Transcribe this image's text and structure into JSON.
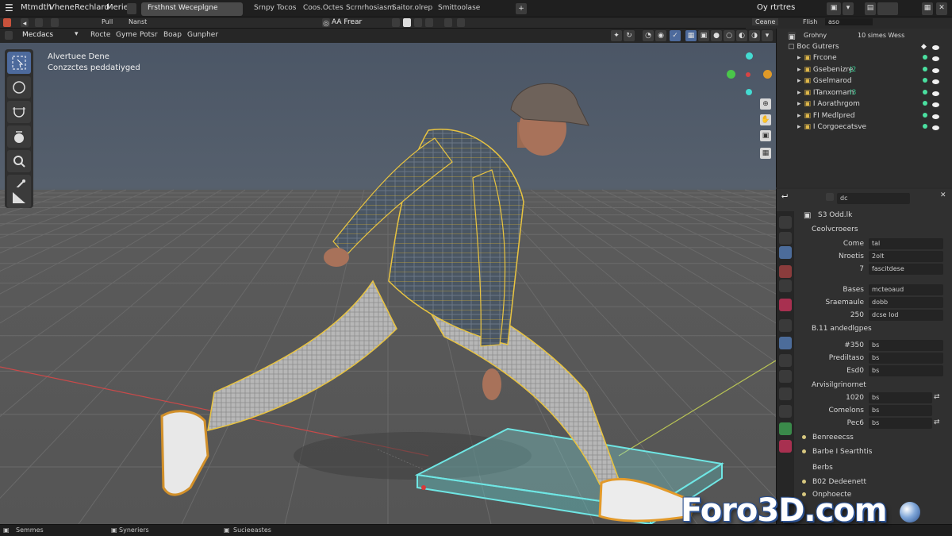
{
  "menubar": {
    "items": [
      "Mtmdth",
      "Vhene",
      "Rechlard",
      "Merie"
    ],
    "active_workspace": "Frsthnst Weceplgne",
    "workspaces": [
      "Srnpy Tocos",
      "Coos.Octes",
      "Scrnrhosiasm",
      "Saitor.olrep",
      "Smittoolase"
    ],
    "right_label": "Oy rtrtres"
  },
  "header": {
    "left_items": [
      "Pull",
      "Nanst"
    ],
    "center_label": "AA Frear",
    "right_items": [
      "Ceane",
      "Flish",
      "aso"
    ]
  },
  "modebar": {
    "mode": "Mecdacs",
    "items": [
      "Rocte",
      "Gyme",
      "Potsr",
      "Boap",
      "Gunpher"
    ]
  },
  "viewport": {
    "overlay_line1": "Alvertuee Dene",
    "overlay_line2": "Conzzctes peddatiyged"
  },
  "outliner": {
    "header": "Grohny",
    "header_right": "10 simes Wess",
    "collection": "Boc Gutrers",
    "items": [
      {
        "name": "Frcone",
        "tag": ""
      },
      {
        "name": "Gsebenizre",
        "tag": "J2"
      },
      {
        "name": "Gselmarod",
        "tag": ""
      },
      {
        "name": "ITanxomam",
        "tag": "I3"
      },
      {
        "name": "I Aorathrgom",
        "tag": ""
      },
      {
        "name": "FI Medlpred",
        "tag": ""
      },
      {
        "name": "I Corgoecatsve",
        "tag": ""
      }
    ]
  },
  "properties": {
    "header_field": "dc",
    "object_name": "S3 Odd.lk",
    "section_title": "Ceolvcroeers",
    "rows_a": [
      {
        "label": "Come",
        "value": "tal"
      },
      {
        "label": "Nroetis",
        "value": "2olt"
      },
      {
        "label": "7",
        "value": "fascitdese"
      }
    ],
    "rows_b": [
      {
        "label": "Bases",
        "value": "mcteoaud"
      },
      {
        "label": "Sraemaule",
        "value": "dobb"
      },
      {
        "label": "250",
        "value": "dcse Iod"
      }
    ],
    "section_b": "B.11 andedlgpes",
    "rows_c": [
      {
        "label": "#350",
        "value": "bs"
      },
      {
        "label": "Prediltaso",
        "value": "bs"
      },
      {
        "label": "Esd0",
        "value": "bs"
      }
    ],
    "section_c": "Arvisilgrinornet",
    "rows_d": [
      {
        "label": "1020",
        "value": "bs"
      },
      {
        "label": "Comelons",
        "value": "bs"
      },
      {
        "label": "Pec6",
        "value": "bs"
      }
    ],
    "list_items": [
      "Benreeecss",
      "Barbe I Searthtis",
      "Berbs",
      "B02 Dedeenett",
      "Onphoecte"
    ]
  },
  "statusbar": {
    "items": [
      "Semmes",
      "Syneriers",
      "Sucieeastes"
    ]
  },
  "watermark": "Foro3D.com",
  "colors": {
    "selection_outline": "#e9c440",
    "active_object": "#6fe6e4",
    "x_axis": "#c94a4a",
    "y_axis": "#b9c455"
  }
}
